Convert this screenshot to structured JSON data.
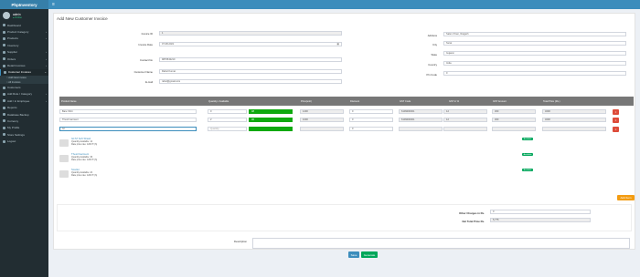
{
  "app": {
    "brand": "PhpInventory",
    "user_name": "admin",
    "user_status": "Online"
  },
  "sidebar": {
    "items": [
      {
        "label": "Dashboard"
      },
      {
        "label": "Product Category"
      },
      {
        "label": "Products"
      },
      {
        "label": "Inventory"
      },
      {
        "label": "Supplier"
      },
      {
        "label": "Orders"
      },
      {
        "label": "Retail Invoices"
      },
      {
        "label": "Customer Invoices"
      },
      {
        "label": "Add New Invoice"
      },
      {
        "label": "All Invoices"
      },
      {
        "label": "Customers"
      },
      {
        "label": "Add Role / Category"
      },
      {
        "label": "Add / in Employee"
      },
      {
        "label": "Reports"
      },
      {
        "label": "Database Backup"
      },
      {
        "label": "Currency"
      },
      {
        "label": "My Profile"
      },
      {
        "label": "Store Settings"
      },
      {
        "label": "Logout"
      }
    ]
  },
  "form": {
    "title": "Add New Customer Invoice",
    "invoice_id_label": "Invoice ID",
    "invoice_id_value": "1",
    "invoice_date_label": "Invoice Date",
    "invoice_date_value": "07-08-2021",
    "contact_label": "Contact No",
    "contact_value": "9876543210",
    "customer_name_label": "Customer Name",
    "customer_name_value": "Rahul Kumar",
    "email_label": "E-mail",
    "email_value": "rahul@gmail.com",
    "address_label": "Address",
    "address_value": "Salem Town, Raigarh",
    "city_label": "City",
    "city_value": "Surat",
    "state_label": "State",
    "state_value": "Gujarat",
    "country_label": "Country",
    "country_value": "India",
    "pincode_label": "Pin Code",
    "pincode_value": "0"
  },
  "table": {
    "headers": [
      "Product Name",
      "Quantity / Available",
      "Price(unit)",
      "Discount",
      "GST Code",
      "GST in %",
      "GST Amount",
      "Total Price (Rs.)"
    ],
    "rows": [
      {
        "name": "Bare Shirt",
        "qty": "0",
        "avail": "48",
        "price": "1200",
        "discount": "0",
        "gst_code": "6109000001",
        "gst_pct": "12",
        "gst_amt": "300",
        "total": "3200",
        "remove": "×"
      },
      {
        "name": "Thesil Garment",
        "qty": "2",
        "avail": "36",
        "price": "1000",
        "discount": "0",
        "gst_code": "6109000001",
        "gst_pct": "12",
        "gst_amt": "300",
        "total": "3200",
        "remove": "×"
      },
      {
        "name": "Gt",
        "qty": "",
        "avail": "",
        "price": "",
        "discount": "0",
        "gst_code": "",
        "gst_pct": "",
        "gst_amt": "",
        "total": "",
        "remove": "×",
        "qty_placeholder": "Quantity"
      }
    ],
    "add_item_button": "Add Item"
  },
  "suggestions": [
    {
      "name": "GLTZ Soft Shawl",
      "available": "Quantity Available: 12",
      "price": "Rate price rate: 1200 ₹ (h)",
      "badge": "Available"
    },
    {
      "name": "Thesil Garment",
      "available": "Quantity Available: 36",
      "price": "Rate price rate: 1200 ₹ (h)",
      "badge": "Available"
    },
    {
      "name": "Scarlet",
      "available": "Quantity Available: 24",
      "price": "Rate price rate: 1200 ₹ (h)",
      "badge": "Available"
    }
  ],
  "summary": {
    "other_charges_label": "Other Charges in Rs.",
    "other_charges_value": "0",
    "net_total_label": "Net Total Price Rs.",
    "net_total_value": "5,775"
  },
  "description": {
    "label": "Description",
    "value": ""
  },
  "actions": {
    "save": "Save",
    "generate": "Generate"
  },
  "colors": {
    "sidebar": "#222d32",
    "header": "#3c8dbc",
    "available": "#0fa90f",
    "remove": "#dd4b39",
    "add_item": "#f39c12",
    "generate": "#00a65a"
  }
}
